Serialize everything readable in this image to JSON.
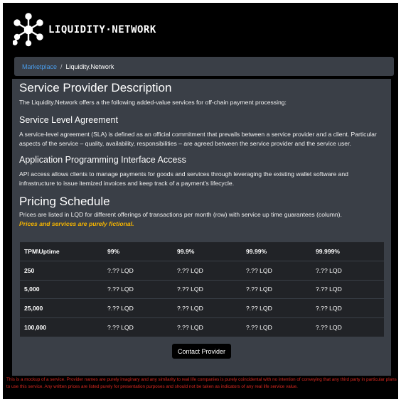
{
  "brand": {
    "name": "LIQUIDITY·NETWORK",
    "logo_icon": "network-node-icon"
  },
  "breadcrumb": {
    "link": "Marketplace",
    "separator": "/",
    "current": "Liquidity.Network"
  },
  "description": {
    "title": "Service Provider Description",
    "intro": "The Liquidity.Network offers a the following added-value services for off-chain payment processing:",
    "sla_title": "Service Level Agreement",
    "sla_text": "A service-level agreement (SLA) is defined as an official commitment that prevails between a service provider and a client. Particular aspects of the service – quality, availability, responsibilities – are agreed between the service provider and the service user.",
    "api_title": "Application Programming Interface Access",
    "api_text": "API access allows clients to manage payments for goods and services through leveraging the existing wallet software and infrastructure to issue itemized invoices and keep track of a payment's lifecycle."
  },
  "pricing": {
    "title": "Pricing Schedule",
    "text": "Prices are listed in LQD for different offerings of transactions per month (row) with service up time guarantees (column).",
    "warning": "Prices and services are purely fictional.",
    "headers": [
      "TPM\\Uptime",
      "99%",
      "99.9%",
      "99.99%",
      "99.999%"
    ],
    "rows": [
      [
        "250",
        "?.?? LQD",
        "?.?? LQD",
        "?.?? LQD",
        "?.?? LQD"
      ],
      [
        "5,000",
        "?.?? LQD",
        "?.?? LQD",
        "?.?? LQD",
        "?.?? LQD"
      ],
      [
        "25,000",
        "?.?? LQD",
        "?.?? LQD",
        "?.?? LQD",
        "?.?? LQD"
      ],
      [
        "100,000",
        "?.?? LQD",
        "?.?? LQD",
        "?.?? LQD",
        "?.?? LQD"
      ]
    ]
  },
  "contact_button": "Contact Provider",
  "disclaimer": "This is a mockup of a service. Provider names are purely imaginary and any similarity to real life companies is purely coincidental with no intention of conveying that any third party in particular plans to use this service. Any written prices are listed purely for presentation purposes and should not be taken as indicators of any real life service value.",
  "colors": {
    "background": "#000000",
    "card": "#3a3f47",
    "table": "#212327",
    "link": "#4a9be8",
    "warning": "#f5b400",
    "disclaimer": "#d9281f"
  }
}
